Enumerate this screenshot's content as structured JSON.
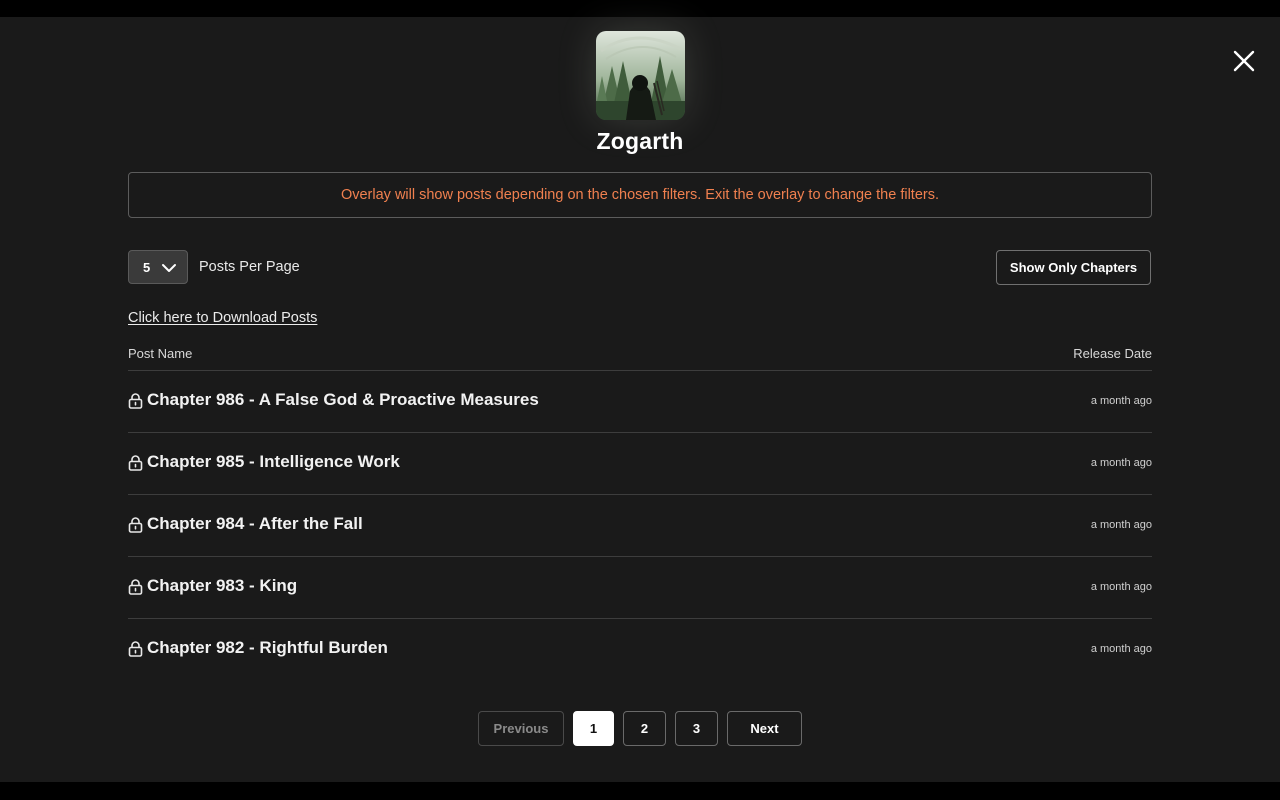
{
  "creator": {
    "name": "Zogarth"
  },
  "notice": {
    "text": "Overlay will show posts depending on the chosen filters. Exit the overlay to change the filters."
  },
  "controls": {
    "per_page_value": "5",
    "per_page_label": "Posts Per Page",
    "show_only_chapters": "Show Only Chapters",
    "download_link": "Click here to Download Posts"
  },
  "table": {
    "col_name": "Post Name",
    "col_date": "Release Date"
  },
  "posts": [
    {
      "title": "Chapter 986 - A False God & Proactive Measures",
      "date": "a month ago",
      "icon": "lock-icon"
    },
    {
      "title": "Chapter 985 - Intelligence Work",
      "date": "a month ago",
      "icon": "lock-icon"
    },
    {
      "title": "Chapter 984 - After the Fall",
      "date": "a month ago",
      "icon": "lock-icon"
    },
    {
      "title": "Chapter 983 - King",
      "date": "a month ago",
      "icon": "lock-icon"
    },
    {
      "title": "Chapter 982 - Rightful Burden",
      "date": "a month ago",
      "icon": "lock-icon"
    }
  ],
  "pagination": {
    "previous": "Previous",
    "pages": [
      "1",
      "2",
      "3"
    ],
    "current": "1",
    "next": "Next"
  },
  "colors": {
    "background": "#1a1a1a",
    "notice_text": "#f0804f",
    "active_page_bg": "#ffffff"
  }
}
